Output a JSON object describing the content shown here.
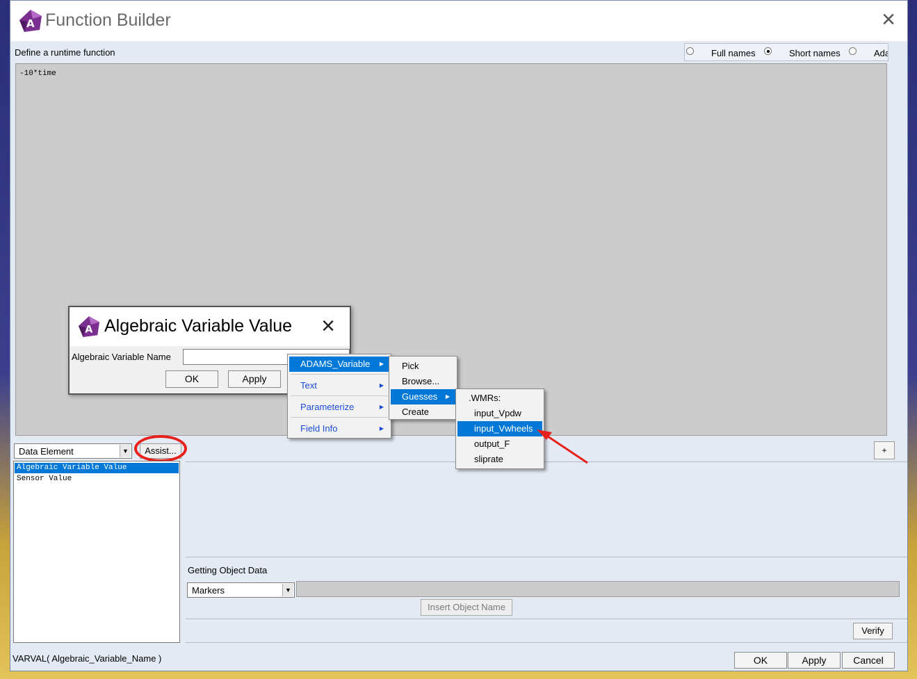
{
  "window": {
    "title": "Function Builder"
  },
  "define_label": "Define a runtime function",
  "name_options": {
    "full_names": "Full names",
    "short_names": "Short names",
    "third": "Ada"
  },
  "editor": {
    "text": "-10*time"
  },
  "category_select": {
    "value": "Data Element"
  },
  "assist_button": "Assist...",
  "plus_button": "+",
  "function_list": [
    "Algebraic Variable Value",
    "Sensor Value"
  ],
  "getting_object_data": {
    "label": "Getting Object Data",
    "select_value": "Markers",
    "insert_button": "Insert Object Name"
  },
  "verify_button": "Verify",
  "syntax_text": "VARVAL( Algebraic_Variable_Name )",
  "footer_buttons": {
    "ok": "OK",
    "apply": "Apply",
    "cancel": "Cancel"
  },
  "alg_dialog": {
    "title": "Algebraic Variable Value",
    "label": "Algebraic Variable Name",
    "ok": "OK",
    "apply": "Apply"
  },
  "menu1": [
    "ADAMS_Variable",
    "Text",
    "Parameterize",
    "Field Info"
  ],
  "menu2": [
    "Pick",
    "Browse...",
    "Guesses",
    "Create"
  ],
  "menu3": {
    "header": ".WMRs:",
    "items": [
      "input_Vpdw",
      "input_Vwheels",
      "output_F",
      "sliprate"
    ]
  },
  "colors": {
    "highlight": "#0078d7",
    "annotation_red": "#e8201c"
  }
}
